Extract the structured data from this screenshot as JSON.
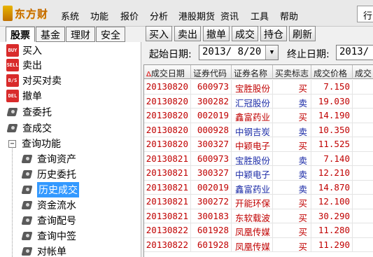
{
  "app": {
    "logo_text": "东方财",
    "menu": [
      "系统",
      "功能",
      "报价",
      "分析",
      "港股期货",
      "资讯",
      "工具",
      "帮助"
    ],
    "menu_right_button": "行"
  },
  "left_tabs": [
    {
      "label": "股票",
      "active": true
    },
    {
      "label": "基金",
      "active": false
    },
    {
      "label": "理财",
      "active": false
    },
    {
      "label": "安全",
      "active": false
    }
  ],
  "tree": {
    "buy": {
      "label": "买入",
      "icon": "buy-icon",
      "icon_text": "BUY"
    },
    "sell": {
      "label": "卖出",
      "icon": "sell-icon",
      "icon_text": "SELL"
    },
    "swap": {
      "label": "对买对卖",
      "icon": "swap-icon",
      "icon_text": "B/S"
    },
    "cancel": {
      "label": "撤单",
      "icon": "cancel-icon",
      "icon_text": "DEL"
    },
    "query_orders": {
      "label": "查委托",
      "icon": "query-icon"
    },
    "query_deals": {
      "label": "查成交",
      "icon": "query-icon"
    },
    "query_func": {
      "label": "查询功能",
      "expander": "−"
    },
    "children": [
      {
        "label": "查询资产",
        "selected": false
      },
      {
        "label": "历史委托",
        "selected": false
      },
      {
        "label": "历史成交",
        "selected": true
      },
      {
        "label": "资金流水",
        "selected": false
      },
      {
        "label": "查询配号",
        "selected": false
      },
      {
        "label": "查询中签",
        "selected": false
      },
      {
        "label": "对帐单",
        "selected": false
      }
    ]
  },
  "toolbar": {
    "buy": "买入",
    "sell": "卖出",
    "cancel": "撤单",
    "deals": "成交",
    "positions": "持仓",
    "refresh": "刷新"
  },
  "filter": {
    "start_label": "起始日期:",
    "start_value": "2013/ 8/20",
    "end_label": "终止日期:",
    "end_value": "2013/"
  },
  "table": {
    "sort_marker": "Δ",
    "headers": [
      "成交日期",
      "证券代码",
      "证券名称",
      "买卖标志",
      "成交价格",
      "成交"
    ],
    "rows": [
      {
        "date": "20130820",
        "code": "600973",
        "name": "宝胜股份",
        "side": "买",
        "side_type": "buy",
        "price": "7.150"
      },
      {
        "date": "20130820",
        "code": "300282",
        "name": "汇冠股份",
        "side": "卖",
        "side_type": "sell",
        "price": "19.030"
      },
      {
        "date": "20130820",
        "code": "002019",
        "name": "鑫富药业",
        "side": "买",
        "side_type": "buy",
        "price": "14.190"
      },
      {
        "date": "20130820",
        "code": "000928",
        "name": "中钢吉炭",
        "side": "卖",
        "side_type": "sell",
        "price": "10.350"
      },
      {
        "date": "20130820",
        "code": "300327",
        "name": "中颖电子",
        "side": "买",
        "side_type": "buy",
        "price": "11.525"
      },
      {
        "date": "20130821",
        "code": "600973",
        "name": "宝胜股份",
        "side": "卖",
        "side_type": "sell",
        "price": "7.140"
      },
      {
        "date": "20130821",
        "code": "300327",
        "name": "中颖电子",
        "side": "卖",
        "side_type": "sell",
        "price": "12.210"
      },
      {
        "date": "20130821",
        "code": "002019",
        "name": "鑫富药业",
        "side": "卖",
        "side_type": "sell",
        "price": "14.870"
      },
      {
        "date": "20130821",
        "code": "300272",
        "name": "开能环保",
        "side": "买",
        "side_type": "buy",
        "price": "12.100"
      },
      {
        "date": "20130821",
        "code": "300183",
        "name": "东软载波",
        "side": "买",
        "side_type": "buy",
        "price": "30.290"
      },
      {
        "date": "20130822",
        "code": "601928",
        "name": "凤凰传媒",
        "side": "买",
        "side_type": "buy",
        "price": "11.280"
      },
      {
        "date": "20130822",
        "code": "601928",
        "name": "凤凰传媒",
        "side": "买",
        "side_type": "buy",
        "price": "11.290"
      }
    ]
  },
  "colors": {
    "buy": "#c00000",
    "sell": "#1a2aa6",
    "selection": "#3399ff"
  }
}
